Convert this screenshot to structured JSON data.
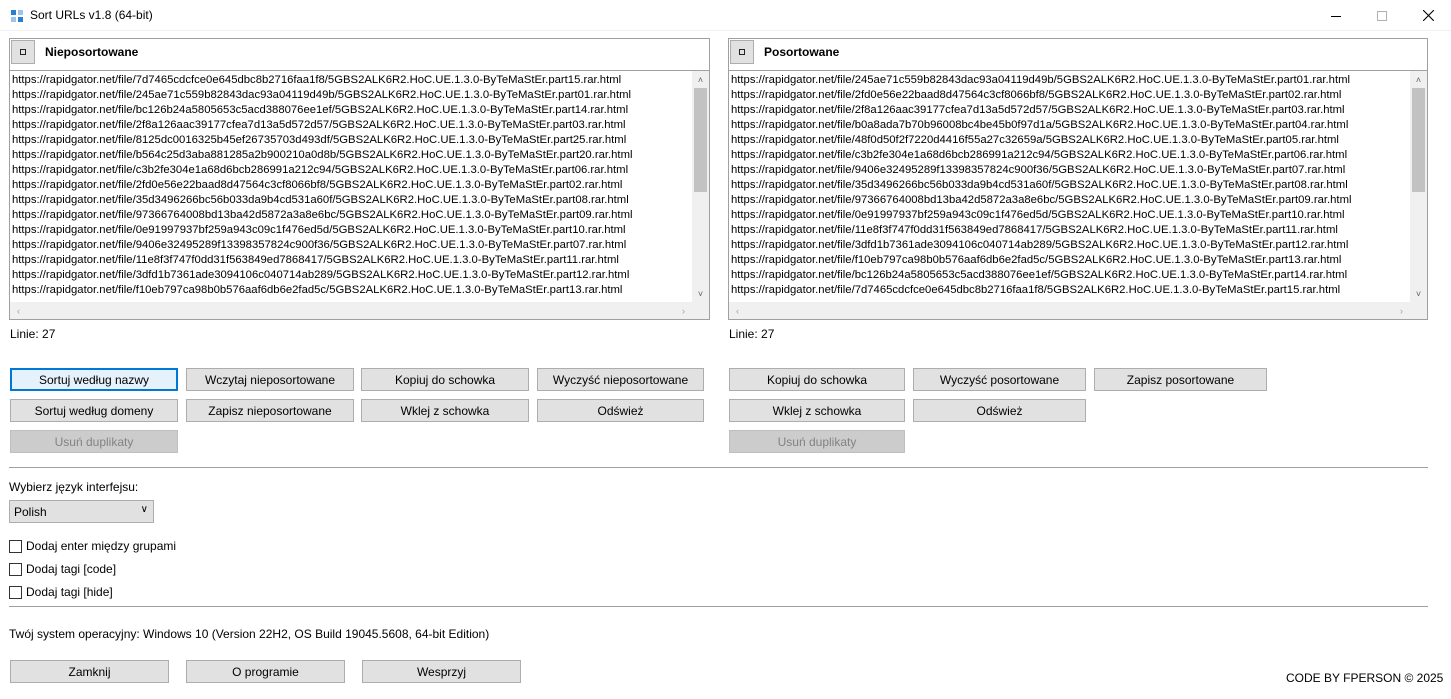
{
  "window": {
    "title": "Sort URLs v1.8 (64-bit)",
    "controls": {
      "minimize_icon": "minimize-icon",
      "maximize_icon": "maximize-icon",
      "close_icon": "close-icon"
    }
  },
  "left_panel": {
    "title": "Nieposortowane",
    "lines": [
      "https://rapidgator.net/file/7d7465cdcfce0e645dbc8b2716faa1f8/5GBS2ALK6R2.HoC.UE.1.3.0-ByTeMaStEr.part15.rar.html",
      "https://rapidgator.net/file/245ae71c559b82843dac93a04119d49b/5GBS2ALK6R2.HoC.UE.1.3.0-ByTeMaStEr.part01.rar.html",
      "https://rapidgator.net/file/bc126b24a5805653c5acd388076ee1ef/5GBS2ALK6R2.HoC.UE.1.3.0-ByTeMaStEr.part14.rar.html",
      "https://rapidgator.net/file/2f8a126aac39177cfea7d13a5d572d57/5GBS2ALK6R2.HoC.UE.1.3.0-ByTeMaStEr.part03.rar.html",
      "https://rapidgator.net/file/8125dc0016325b45ef26735703d493df/5GBS2ALK6R2.HoC.UE.1.3.0-ByTeMaStEr.part25.rar.html",
      "https://rapidgator.net/file/b564c25d3aba881285a2b900210a0d8b/5GBS2ALK6R2.HoC.UE.1.3.0-ByTeMaStEr.part20.rar.html",
      "https://rapidgator.net/file/c3b2fe304e1a68d6bcb286991a212c94/5GBS2ALK6R2.HoC.UE.1.3.0-ByTeMaStEr.part06.rar.html",
      "https://rapidgator.net/file/2fd0e56e22baad8d47564c3cf8066bf8/5GBS2ALK6R2.HoC.UE.1.3.0-ByTeMaStEr.part02.rar.html",
      "https://rapidgator.net/file/35d3496266bc56b033da9b4cd531a60f/5GBS2ALK6R2.HoC.UE.1.3.0-ByTeMaStEr.part08.rar.html",
      "https://rapidgator.net/file/97366764008bd13ba42d5872a3a8e6bc/5GBS2ALK6R2.HoC.UE.1.3.0-ByTeMaStEr.part09.rar.html",
      "https://rapidgator.net/file/0e91997937bf259a943c09c1f476ed5d/5GBS2ALK6R2.HoC.UE.1.3.0-ByTeMaStEr.part10.rar.html",
      "https://rapidgator.net/file/9406e32495289f13398357824c900f36/5GBS2ALK6R2.HoC.UE.1.3.0-ByTeMaStEr.part07.rar.html",
      "https://rapidgator.net/file/11e8f3f747f0dd31f563849ed7868417/5GBS2ALK6R2.HoC.UE.1.3.0-ByTeMaStEr.part11.rar.html",
      "https://rapidgator.net/file/3dfd1b7361ade3094106c040714ab289/5GBS2ALK6R2.HoC.UE.1.3.0-ByTeMaStEr.part12.rar.html",
      "https://rapidgator.net/file/f10eb797ca98b0b576aaf6db6e2fad5c/5GBS2ALK6R2.HoC.UE.1.3.0-ByTeMaStEr.part13.rar.html"
    ],
    "line_count": "Linie: 27",
    "buttons": {
      "sort_by_name": "Sortuj według nazwy",
      "load_unsorted": "Wczytaj nieposortowane",
      "copy_clipboard": "Kopiuj do schowka",
      "clear_unsorted": "Wyczyść nieposortowane",
      "sort_by_domain": "Sortuj według domeny",
      "save_unsorted": "Zapisz nieposortowane",
      "paste_clipboard": "Wklej z schowka",
      "refresh": "Odśwież",
      "remove_duplicates": "Usuń duplikaty"
    }
  },
  "right_panel": {
    "title": "Posortowane",
    "lines": [
      "https://rapidgator.net/file/245ae71c559b82843dac93a04119d49b/5GBS2ALK6R2.HoC.UE.1.3.0-ByTeMaStEr.part01.rar.html",
      "https://rapidgator.net/file/2fd0e56e22baad8d47564c3cf8066bf8/5GBS2ALK6R2.HoC.UE.1.3.0-ByTeMaStEr.part02.rar.html",
      "https://rapidgator.net/file/2f8a126aac39177cfea7d13a5d572d57/5GBS2ALK6R2.HoC.UE.1.3.0-ByTeMaStEr.part03.rar.html",
      "https://rapidgator.net/file/b0a8ada7b70b96008bc4be45b0f97d1a/5GBS2ALK6R2.HoC.UE.1.3.0-ByTeMaStEr.part04.rar.html",
      "https://rapidgator.net/file/48f0d50f2f7220d4416f55a27c32659a/5GBS2ALK6R2.HoC.UE.1.3.0-ByTeMaStEr.part05.rar.html",
      "https://rapidgator.net/file/c3b2fe304e1a68d6bcb286991a212c94/5GBS2ALK6R2.HoC.UE.1.3.0-ByTeMaStEr.part06.rar.html",
      "https://rapidgator.net/file/9406e32495289f13398357824c900f36/5GBS2ALK6R2.HoC.UE.1.3.0-ByTeMaStEr.part07.rar.html",
      "https://rapidgator.net/file/35d3496266bc56b033da9b4cd531a60f/5GBS2ALK6R2.HoC.UE.1.3.0-ByTeMaStEr.part08.rar.html",
      "https://rapidgator.net/file/97366764008bd13ba42d5872a3a8e6bc/5GBS2ALK6R2.HoC.UE.1.3.0-ByTeMaStEr.part09.rar.html",
      "https://rapidgator.net/file/0e91997937bf259a943c09c1f476ed5d/5GBS2ALK6R2.HoC.UE.1.3.0-ByTeMaStEr.part10.rar.html",
      "https://rapidgator.net/file/11e8f3f747f0dd31f563849ed7868417/5GBS2ALK6R2.HoC.UE.1.3.0-ByTeMaStEr.part11.rar.html",
      "https://rapidgator.net/file/3dfd1b7361ade3094106c040714ab289/5GBS2ALK6R2.HoC.UE.1.3.0-ByTeMaStEr.part12.rar.html",
      "https://rapidgator.net/file/f10eb797ca98b0b576aaf6db6e2fad5c/5GBS2ALK6R2.HoC.UE.1.3.0-ByTeMaStEr.part13.rar.html",
      "https://rapidgator.net/file/bc126b24a5805653c5acd388076ee1ef/5GBS2ALK6R2.HoC.UE.1.3.0-ByTeMaStEr.part14.rar.html",
      "https://rapidgator.net/file/7d7465cdcfce0e645dbc8b2716faa1f8/5GBS2ALK6R2.HoC.UE.1.3.0-ByTeMaStEr.part15.rar.html"
    ],
    "line_count": "Linie: 27",
    "buttons": {
      "copy_clipboard": "Kopiuj do schowka",
      "clear_sorted": "Wyczyść posortowane",
      "save_sorted": "Zapisz posortowane",
      "paste_clipboard": "Wklej z schowka",
      "refresh": "Odśwież",
      "remove_duplicates": "Usuń duplikaty"
    }
  },
  "settings": {
    "language_label": "Wybierz język interfejsu:",
    "language_value": "Polish",
    "checkboxes": {
      "enter_between_groups": "Dodaj enter między grupami",
      "code_tags": "Dodaj tagi [code]",
      "hide_tags": "Dodaj tagi [hide]"
    }
  },
  "os_info": {
    "label": "Twój system operacyjny:",
    "value": "Windows 10 (Version 22H2, OS Build 19045.5608, 64-bit Edition)"
  },
  "footer": {
    "close": "Zamknij",
    "about": "O programie",
    "support": "Wesprzyj",
    "credit": "CODE BY FPERSON © 2025"
  },
  "colors": {
    "button_bg": "#e1e1e1",
    "focus_border": "#0078d7",
    "scrollbar_thumb": "#c2c2c2"
  }
}
